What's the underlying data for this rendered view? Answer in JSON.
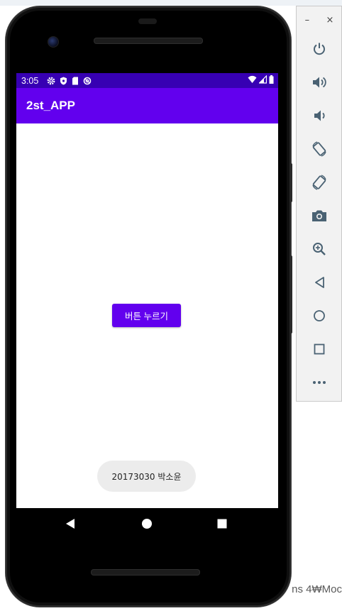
{
  "background": {
    "bottom_text": "ns 4₩Moc"
  },
  "status_bar": {
    "time": "3:05",
    "left_icons": [
      "settings-icon",
      "shield-icon",
      "sd-card-icon",
      "data-saver-icon"
    ],
    "right_icons": [
      "wifi-icon",
      "signal-icon",
      "battery-icon"
    ]
  },
  "app": {
    "title": "2st_APP",
    "button_label": "버튼 누르기",
    "toast_text": "20173030 박소윤",
    "colors": {
      "status_bar": "#3700b3",
      "primary": "#6200ee"
    }
  },
  "nav": {
    "buttons": [
      "back-icon",
      "home-icon",
      "recents-icon"
    ]
  },
  "toolbar": {
    "minimize_label": "–",
    "close_label": "×",
    "items": [
      {
        "name": "power-button",
        "icon": "power-icon"
      },
      {
        "name": "volume-up-button",
        "icon": "volume-up-icon"
      },
      {
        "name": "volume-down-button",
        "icon": "volume-down-icon"
      },
      {
        "name": "rotate-left-button",
        "icon": "rotate-left-icon"
      },
      {
        "name": "rotate-right-button",
        "icon": "rotate-right-icon"
      },
      {
        "name": "screenshot-button",
        "icon": "camera-icon"
      },
      {
        "name": "zoom-button",
        "icon": "zoom-icon"
      },
      {
        "name": "back-button",
        "icon": "back-icon"
      },
      {
        "name": "home-button",
        "icon": "home-icon"
      },
      {
        "name": "overview-button",
        "icon": "overview-icon"
      },
      {
        "name": "more-button",
        "icon": "more-icon"
      }
    ]
  }
}
